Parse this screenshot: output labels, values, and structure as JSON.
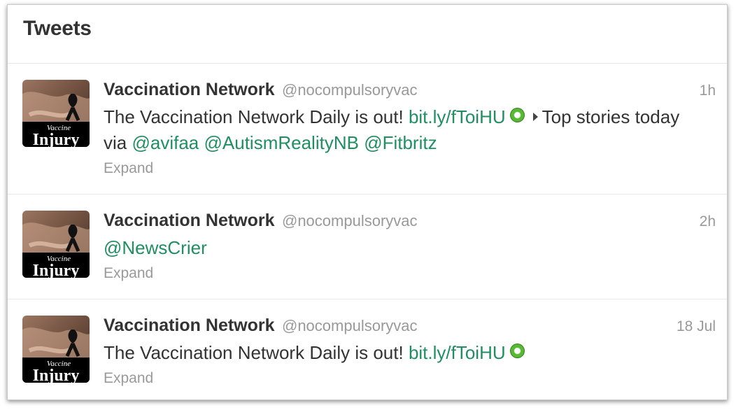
{
  "header": {
    "title": "Tweets"
  },
  "tweets": [
    {
      "name": "Vaccination Network",
      "handle": "@nocompulsoryvac",
      "time": "1h",
      "text_start": "The Vaccination Network Daily is out!",
      "link": "bit.ly/fToiHU",
      "text_mid": "Top stories today via",
      "mentions": [
        "@avifaa",
        "@AutismRealityNB",
        "@Fitbritz"
      ],
      "expand": "Expand"
    },
    {
      "name": "Vaccination Network",
      "handle": "@nocompulsoryvac",
      "time": "2h",
      "mention": "@NewsCrier",
      "expand": "Expand"
    },
    {
      "name": "Vaccination Network",
      "handle": "@nocompulsoryvac",
      "time": "18 Jul",
      "text_start": "The Vaccination Network Daily is out!",
      "link": "bit.ly/fToiHU",
      "expand": "Expand"
    }
  ],
  "avatar": {
    "caption_small": "Vaccine",
    "caption_big": "Injury",
    "bg": "#7a5c4a",
    "ribbon": "#111111"
  },
  "colors": {
    "link": "#1f8f62",
    "text": "#333333",
    "muted": "#999999"
  }
}
